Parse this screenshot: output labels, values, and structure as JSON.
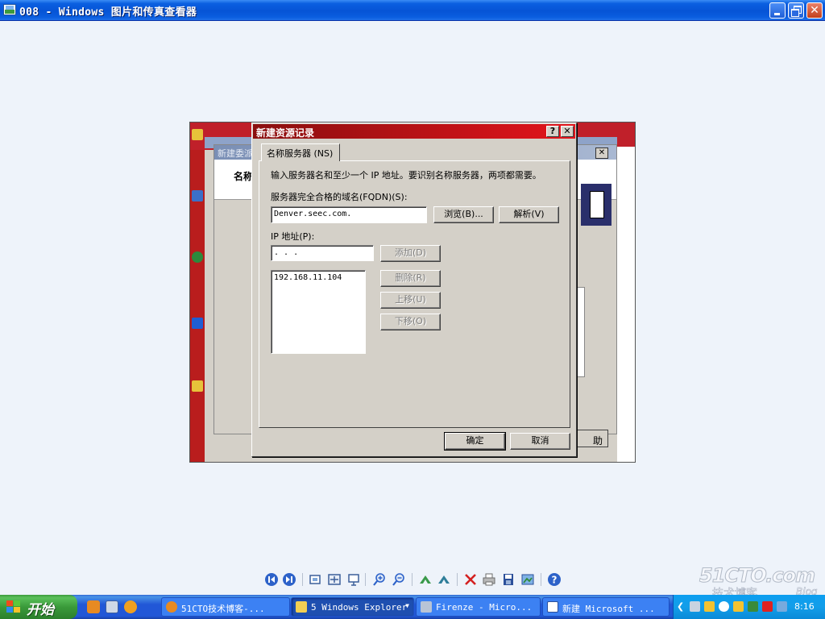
{
  "window": {
    "title": "008 - Windows 图片和传真查看器"
  },
  "background_windows": {
    "caption": "新建委派",
    "heading": "名称",
    "help_label": "助"
  },
  "dialog": {
    "title": "新建资源记录",
    "help_glyph": "?",
    "close_glyph": "✕",
    "tab": "名称服务器 (NS)",
    "instructions": "输入服务器名和至少一个 IP 地址。要识别名称服务器，两项都需要。",
    "fqdn_label": "服务器完全合格的域名(FQDN)(S):",
    "fqdn_value": "Denver.seec.com.",
    "browse_button": "浏览(B)...",
    "resolve_button": "解析(V)",
    "ip_label": "IP 地址(P):",
    "ip_value": "   .   .   .",
    "add_button": "添加(D)",
    "ip_list": [
      "192.168.11.104"
    ],
    "delete_button": "删除(R)",
    "up_button": "上移(U)",
    "down_button": "下移(O)",
    "ok_button": "确定",
    "cancel_button": "取消"
  },
  "viewer_toolbar": {
    "icons": [
      "previous-icon",
      "next-icon",
      "best-fit-icon",
      "actual-size-icon",
      "slideshow-icon",
      "zoom-in-icon",
      "zoom-out-icon",
      "rotate-clockwise-icon",
      "rotate-counterclockwise-icon",
      "delete-icon",
      "print-icon",
      "save-icon",
      "open-editor-icon",
      "help-icon"
    ]
  },
  "taskbar": {
    "start_label": "开始",
    "tasks": [
      {
        "label": "51CTO技术博客-...",
        "icon": "browser-icon"
      },
      {
        "label": "5 Windows Explorer",
        "icon": "folder-icon"
      },
      {
        "label": "Firenze - Micro...",
        "icon": "vm-icon"
      },
      {
        "label": "新建 Microsoft ...",
        "icon": "word-icon"
      }
    ],
    "clock": "8:16"
  },
  "watermark": {
    "line1": "51CTO.com",
    "line2": "技术博客",
    "line3": "Blog"
  }
}
